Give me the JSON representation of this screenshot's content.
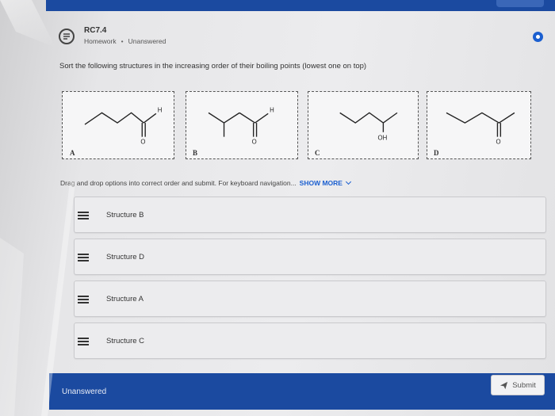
{
  "header": {
    "title": "RC7.4",
    "category": "Homework",
    "status": "Unanswered"
  },
  "question": "Sort the following structures in the increasing order of their boiling points (lowest one on top)",
  "structures": [
    {
      "letter": "A",
      "labels": {
        "top": "H",
        "bottom": "O"
      }
    },
    {
      "letter": "B",
      "labels": {
        "top": "H",
        "bottom": "O"
      }
    },
    {
      "letter": "C",
      "labels": {
        "bottom": "OH"
      }
    },
    {
      "letter": "D",
      "labels": {
        "bottom": "O"
      }
    }
  ],
  "instructions": {
    "text": "Drag and drop options into correct order and submit. For keyboard navigation...",
    "show_more": "SHOW MORE"
  },
  "drag_items": [
    {
      "label": "Structure B"
    },
    {
      "label": "Structure D"
    },
    {
      "label": "Structure A"
    },
    {
      "label": "Structure C"
    }
  ],
  "footer": {
    "status": "Unanswered",
    "submit_label": "Submit"
  },
  "colors": {
    "accent": "#1b4aa0",
    "link": "#1b5fd0"
  },
  "icons": {
    "header": "worksheet-icon",
    "status": "radio-dot-icon",
    "drag": "drag-handle-icon",
    "submit": "paper-plane-icon"
  }
}
